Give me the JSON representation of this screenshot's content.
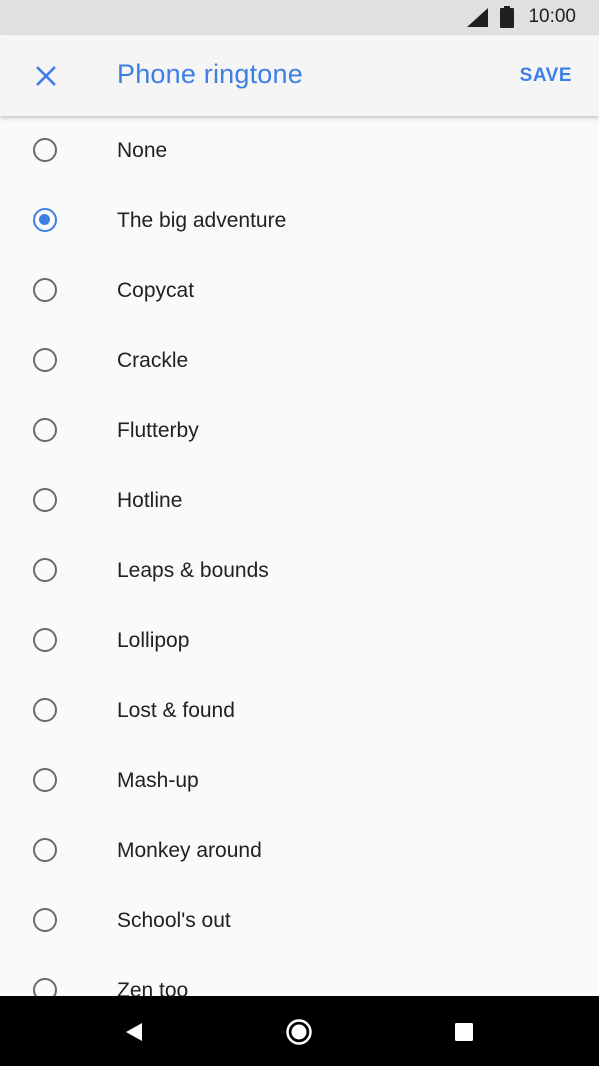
{
  "status_bar": {
    "time": "10:00",
    "icons": [
      "signal-icon",
      "battery-icon"
    ]
  },
  "app_bar": {
    "title": "Phone ringtone",
    "save_label": "SAVE",
    "close_icon": "close-icon"
  },
  "colors": {
    "accent": "#3d7fe5",
    "text": "#212121",
    "background": "#fafafa",
    "status_bar": "#e0e0e0",
    "nav_bar": "#000000"
  },
  "ringtones": [
    {
      "label": "None",
      "selected": false
    },
    {
      "label": "The big adventure",
      "selected": true
    },
    {
      "label": "Copycat",
      "selected": false
    },
    {
      "label": "Crackle",
      "selected": false
    },
    {
      "label": "Flutterby",
      "selected": false
    },
    {
      "label": "Hotline",
      "selected": false
    },
    {
      "label": "Leaps & bounds",
      "selected": false
    },
    {
      "label": "Lollipop",
      "selected": false
    },
    {
      "label": "Lost & found",
      "selected": false
    },
    {
      "label": "Mash-up",
      "selected": false
    },
    {
      "label": "Monkey around",
      "selected": false
    },
    {
      "label": "School's out",
      "selected": false
    },
    {
      "label": "Zen too",
      "selected": false
    }
  ],
  "nav_bar": {
    "icons": [
      "back-icon",
      "home-icon",
      "recents-icon"
    ]
  }
}
